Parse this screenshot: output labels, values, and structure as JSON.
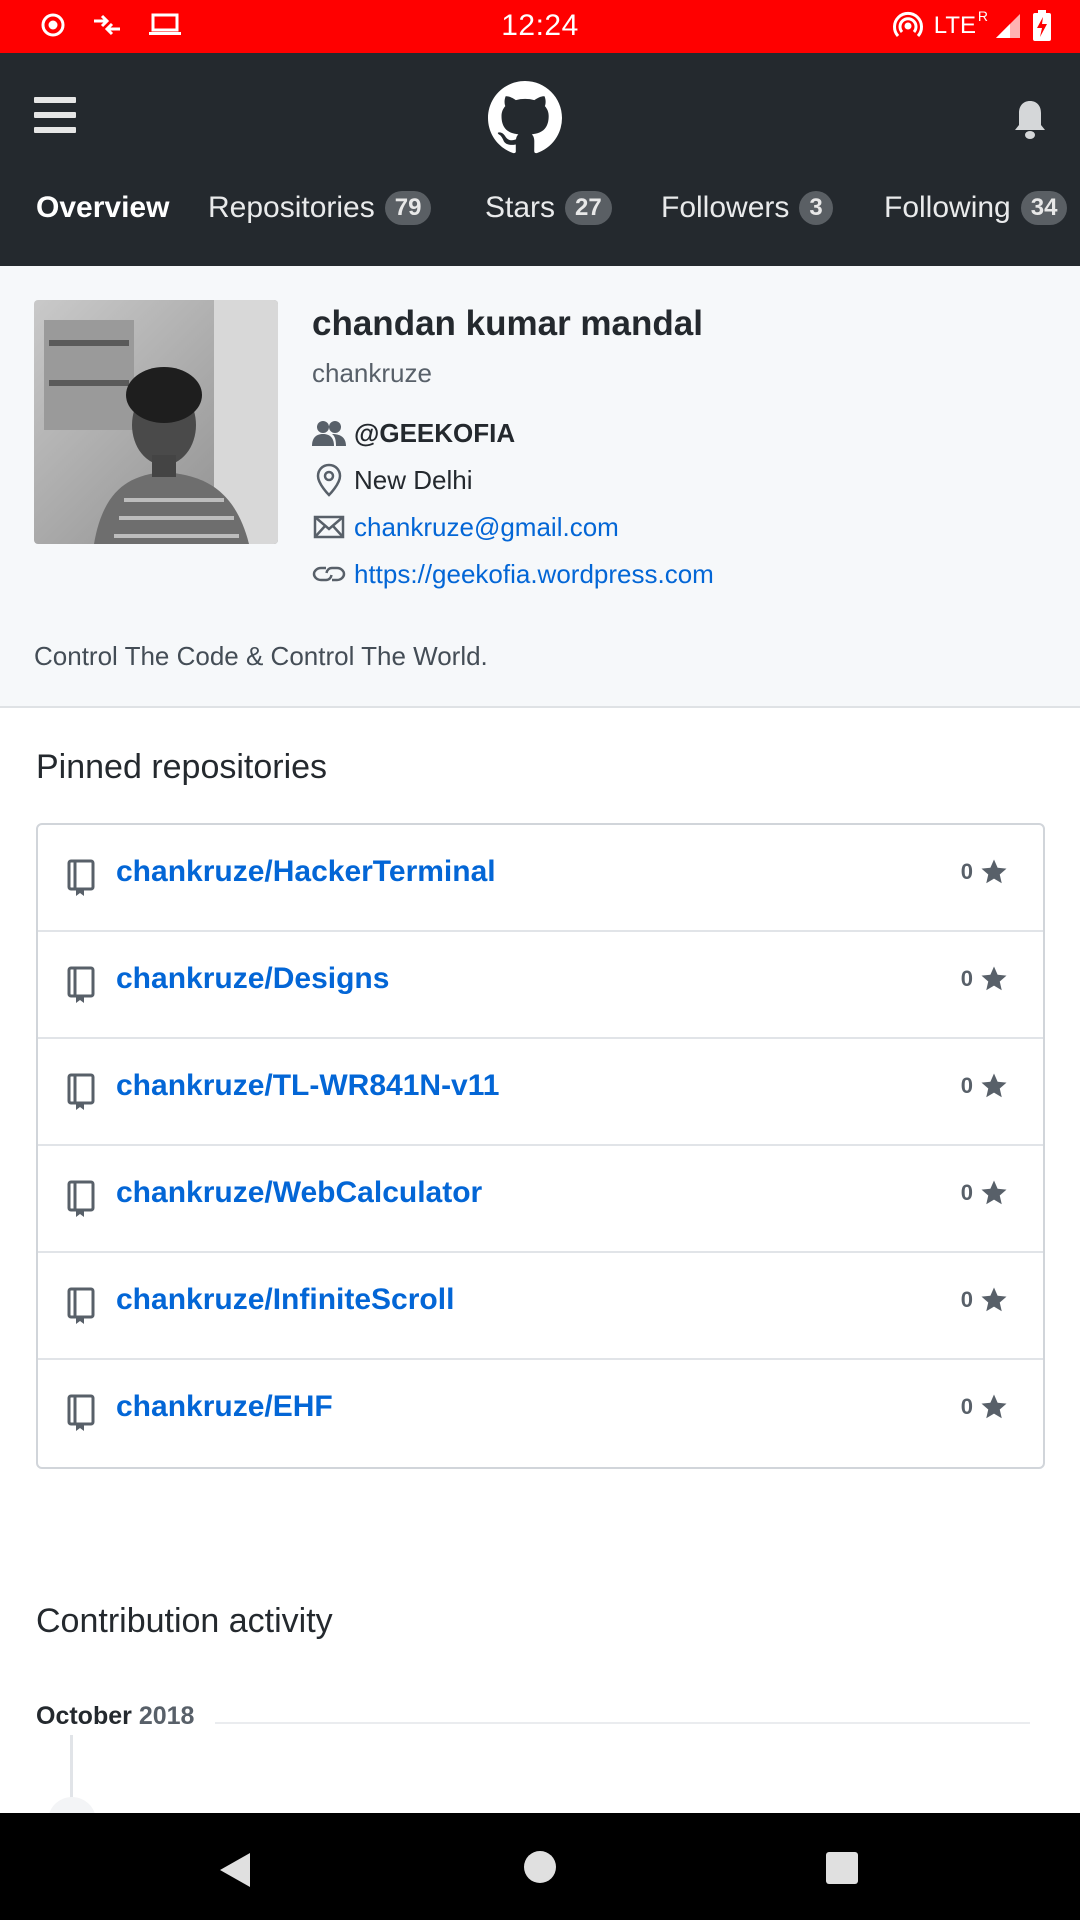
{
  "status_bar": {
    "time": "12:24",
    "network": "LTE",
    "roaming": "R",
    "icons": [
      "record-icon",
      "data-transfer-icon",
      "laptop-icon",
      "hotspot-icon",
      "signal-icon",
      "battery-charging-icon"
    ]
  },
  "header": {
    "logo": "github-octocat-icon",
    "menu_icon": "hamburger-menu-icon",
    "notification_icon": "bell-icon",
    "tabs": [
      {
        "label": "Overview",
        "count": ""
      },
      {
        "label": "Repositories",
        "count": "79"
      },
      {
        "label": "Stars",
        "count": "27"
      },
      {
        "label": "Followers",
        "count": "3"
      },
      {
        "label": "Following",
        "count": "34"
      }
    ]
  },
  "profile": {
    "name": "chandan kumar mandal",
    "login": "chankruze",
    "organization": "@GEEKOFIA",
    "location": "New Delhi",
    "email": "chankruze@gmail.com",
    "website": "https://geekofia.wordpress.com",
    "bio": "Control The Code & Control The World."
  },
  "pinned": {
    "title": "Pinned repositories",
    "repos": [
      {
        "name": "chankruze/HackerTerminal",
        "stars": "0"
      },
      {
        "name": "chankruze/Designs",
        "stars": "0"
      },
      {
        "name": "chankruze/TL-WR841N-v11",
        "stars": "0"
      },
      {
        "name": "chankruze/WebCalculator",
        "stars": "0"
      },
      {
        "name": "chankruze/InfiniteScroll",
        "stars": "0"
      },
      {
        "name": "chankruze/EHF",
        "stars": "0"
      }
    ]
  },
  "contribution": {
    "title": "Contribution activity",
    "month": "October",
    "year": "2018"
  },
  "colors": {
    "status_bar": "#ff0000",
    "header": "#24292e",
    "link": "#0366d6",
    "profile_bg": "#f6f8fa"
  }
}
